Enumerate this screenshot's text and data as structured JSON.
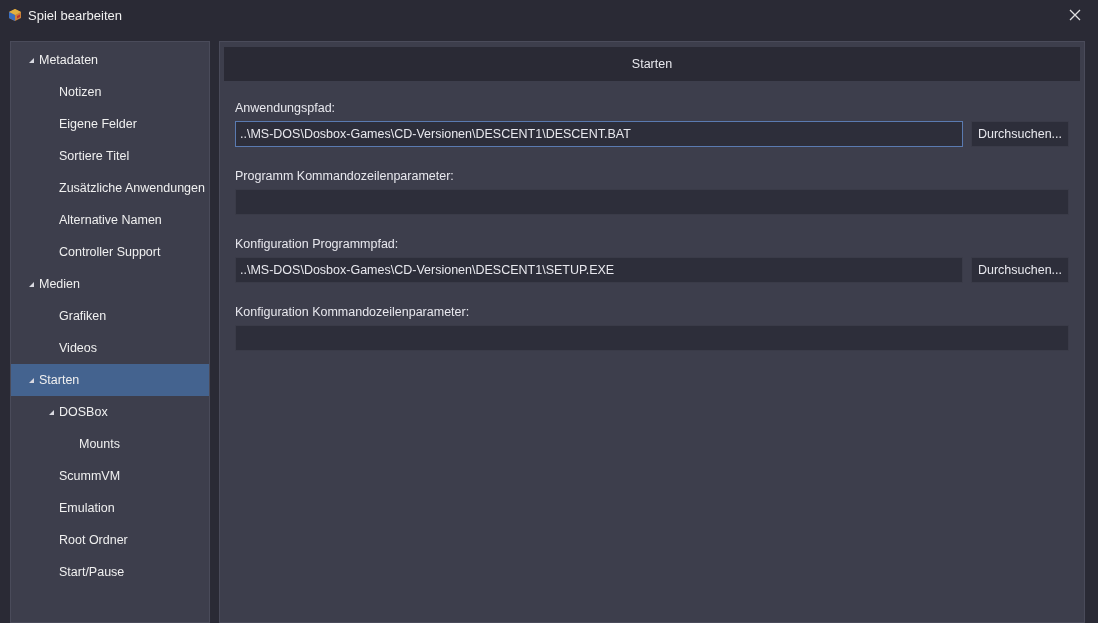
{
  "window": {
    "title": "Spiel bearbeiten"
  },
  "sidebar": {
    "items": [
      {
        "label": "Metadaten",
        "expanded": true,
        "selected": false,
        "children": [
          {
            "label": "Notizen",
            "selected": false
          },
          {
            "label": "Eigene Felder",
            "selected": false
          },
          {
            "label": "Sortiere Titel",
            "selected": false
          },
          {
            "label": "Zusätzliche Anwendungen",
            "selected": false
          },
          {
            "label": "Alternative Namen",
            "selected": false
          },
          {
            "label": "Controller Support",
            "selected": false
          }
        ]
      },
      {
        "label": "Medien",
        "expanded": true,
        "selected": false,
        "children": [
          {
            "label": "Grafiken",
            "selected": false
          },
          {
            "label": "Videos",
            "selected": false
          }
        ]
      },
      {
        "label": "Starten",
        "expanded": true,
        "selected": true,
        "children": [
          {
            "label": "DOSBox",
            "expanded": true,
            "selected": false,
            "children": [
              {
                "label": "Mounts",
                "selected": false
              }
            ]
          },
          {
            "label": "ScummVM",
            "selected": false
          },
          {
            "label": "Emulation",
            "selected": false
          },
          {
            "label": "Root Ordner",
            "selected": false
          },
          {
            "label": "Start/Pause",
            "selected": false
          }
        ]
      }
    ]
  },
  "main": {
    "header": "Starten",
    "fields": [
      {
        "kind": "path",
        "label": "Anwendungspfad:",
        "value": "..\\MS-DOS\\Dosbox-Games\\CD-Versionen\\DESCENT1\\DESCENT.BAT",
        "focused": true,
        "button": "Durchsuchen..."
      },
      {
        "kind": "text",
        "label": "Programm Kommandozeilenparameter:",
        "focused": false
      },
      {
        "kind": "path",
        "label": "Konfiguration Programmpfad:",
        "value": "..\\MS-DOS\\Dosbox-Games\\CD-Versionen\\DESCENT1\\SETUP.EXE",
        "focused": false,
        "button": "Durchsuchen..."
      },
      {
        "kind": "text",
        "label": "Konfiguration Kommandozeilenparameter:",
        "focused": false
      }
    ]
  }
}
